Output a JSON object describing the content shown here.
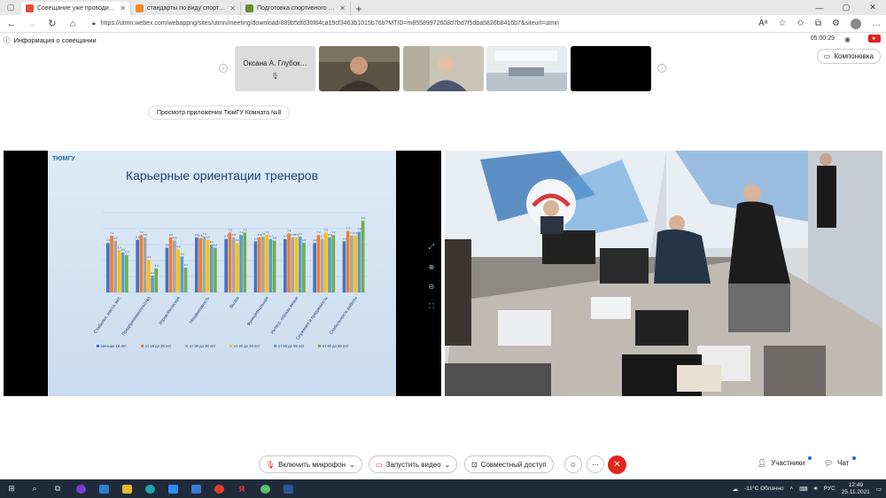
{
  "browser": {
    "tabs": [
      {
        "title": "Совещание уже проводится",
        "fav_color": "#e24b3b",
        "active": true
      },
      {
        "title": "стандарты по виду спорта — Я",
        "fav_color": "#f08a24",
        "active": false
      },
      {
        "title": "Подготовка спортивного резе…",
        "fav_color": "#6d8a2f",
        "active": false
      }
    ],
    "url": "https://utmn.webex.com/webappng/sites/utmn/meeting/download/889b5dfd30f84ca19cf3463b1015b76b?MTID=m85589972608d7bd7f5dba5826b8416b7&siteurl=utmn"
  },
  "meeting": {
    "info_label": "Информация о совещании",
    "timer": "05:00:29",
    "layout_label": "Компоновка",
    "app_view_label": "Просмотр приложения ТюмГУ Комната №8",
    "participant_name": "Оксана А. Глубок…"
  },
  "slide": {
    "logo_text": "ТЮМГУ",
    "title": "Карьерные ориентации тренеров"
  },
  "chart_data": {
    "type": "bar",
    "title": "Карьерные ориентации тренеров",
    "categories": [
      "Стабильн. места жит.",
      "Предпринимательство",
      "Управленческая",
      "Независимость",
      "Вызов",
      "Функциональная",
      "Интегр. образа жизни",
      "Служение и преданность",
      "Стабильность работы"
    ],
    "series": [
      {
        "name": "меньше 18 лет",
        "color": "#4472c4",
        "values": [
          6.2,
          6.6,
          5.6,
          6.9,
          6.7,
          6.4,
          6.7,
          6.2,
          6.4
        ]
      },
      {
        "name": "от 18 до 29 лет",
        "color": "#ed7d31",
        "values": [
          7.1,
          7.2,
          6.9,
          6.8,
          7.5,
          6.9,
          7.4,
          7.2,
          7.7
        ]
      },
      {
        "name": "от 30 до 39 лет",
        "color": "#a5a5a5",
        "values": [
          6.5,
          6.9,
          6.5,
          7.0,
          6.9,
          7.0,
          6.9,
          6.7,
          7.1
        ]
      },
      {
        "name": "от 40 до 49 лет",
        "color": "#ffc000",
        "values": [
          5.3,
          4.1,
          5.4,
          6.6,
          6.2,
          7.2,
          6.9,
          7.5,
          7.1
        ]
      },
      {
        "name": "от 50 до 59 лет",
        "color": "#5b9bd5",
        "values": [
          5.0,
          2.1,
          4.5,
          6.0,
          7.2,
          6.7,
          7.0,
          6.9,
          7.6
        ]
      },
      {
        "name": "от 60 до 69 лет",
        "color": "#70ad47",
        "values": [
          4.7,
          3.0,
          3.1,
          5.6,
          7.5,
          6.5,
          6.2,
          7.2,
          9.0
        ]
      }
    ],
    "ylim": [
      0,
      10
    ]
  },
  "toolbar": {
    "mic_label": "Включить микрофон",
    "video_label": "Запустить видео",
    "share_label": "Совместный доступ",
    "participants_label": "Участники",
    "chat_label": "Чат"
  },
  "taskbar": {
    "weather": "-11°C  Облачно",
    "lang": "РУС",
    "time": "12:49",
    "date": "25.11.2021"
  },
  "colors": {
    "end_call": "#e1251b",
    "taskbar": "#1f2b3a",
    "accent": "#0a70d6"
  }
}
